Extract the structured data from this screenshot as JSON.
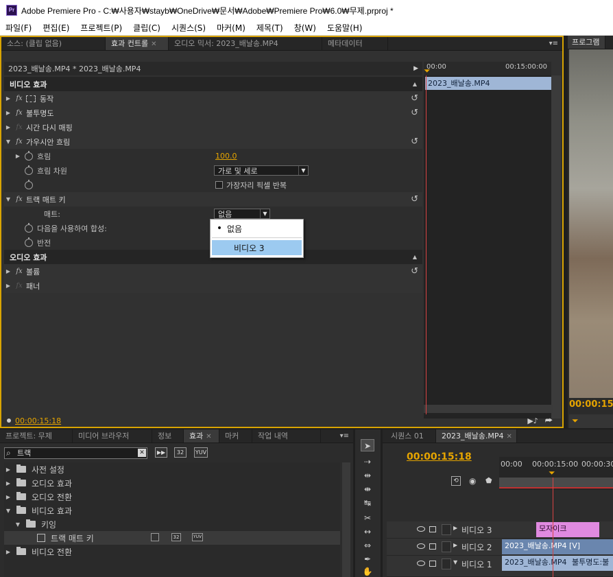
{
  "window": {
    "title": "Adobe Premiere Pro - C:₩사용자₩stayb₩OneDrive₩문서₩Adobe₩Premiere Pro₩6.0₩무제.prproj *",
    "icon_label": "Pr"
  },
  "menubar": [
    "파일(F)",
    "편집(E)",
    "프로젝트(P)",
    "클립(C)",
    "시퀀스(S)",
    "마커(M)",
    "제목(T)",
    "창(W)",
    "도움말(H)"
  ],
  "top_tabs": {
    "source": "소스: (클립 없음)",
    "effect_controls": "효과 컨트롤",
    "audio_mixer": "오디오 믹서: 2023_배날송.MP4",
    "metadata": "메타데이터",
    "program": "프로그램"
  },
  "effect_controls": {
    "clip_path": "2023_배날송.MP4 * 2023_배날송.MP4",
    "ruler_start": "00:00",
    "ruler_end": "00:15:00:00",
    "timeline_clip": "2023_배날송.MP4",
    "timecode": "00:00:15:18",
    "video_section": "비디오 효과",
    "audio_section": "오디오 효과",
    "motion": "동작",
    "opacity": "불투명도",
    "time_remap": "시간 다시 매핑",
    "gaussian_blur": "가우시안 흐림",
    "blur_label": "흐림",
    "blur_value": "100.0",
    "blur_dim_label": "흐림 차원",
    "blur_dim_value": "가로 및 세로",
    "repeat_edge": "가장자리 픽셀 반복",
    "track_matte": "트랙 매트 키",
    "matte_label": "매트:",
    "matte_value": "없음",
    "composite_label": "다음을 사용하여 합성:",
    "reverse_label": "반전",
    "volume": "볼륨",
    "panner": "패너"
  },
  "matte_dropdown": {
    "options": [
      "없음",
      "비디오 3"
    ],
    "checked": "없음",
    "highlighted": "비디오 3"
  },
  "program_monitor": {
    "timecode": "00:00:15:"
  },
  "bottom_tabs": {
    "project": "프로젝트: 무제",
    "media_browser": "미디어 브라우저",
    "info": "정보",
    "effects": "효과",
    "markers": "마커",
    "history": "작업 내역"
  },
  "effects_panel": {
    "search_value": "트랙",
    "badges": [
      "32",
      "YUV"
    ],
    "tree": [
      "사전 설정",
      "오디오 효과",
      "오디오 전환",
      "비디오 효과",
      "키잉",
      "트랙 매트 키",
      "비디오 전환"
    ]
  },
  "sequence": {
    "tabs": [
      "시퀀스 01",
      "2023_배날송.MP4"
    ],
    "timecode": "00:00:15:18",
    "ruler": [
      "00:00",
      "00:00:15:00",
      "00:00:30"
    ],
    "tracks": [
      "비디오 3",
      "비디오 2",
      "비디오 1"
    ],
    "clips": {
      "v3": "모자이크",
      "v2": "2023_배날송.MP4 [V]",
      "v1": "2023_배날송.MP4",
      "v1_effect": "불투명도:불"
    }
  }
}
